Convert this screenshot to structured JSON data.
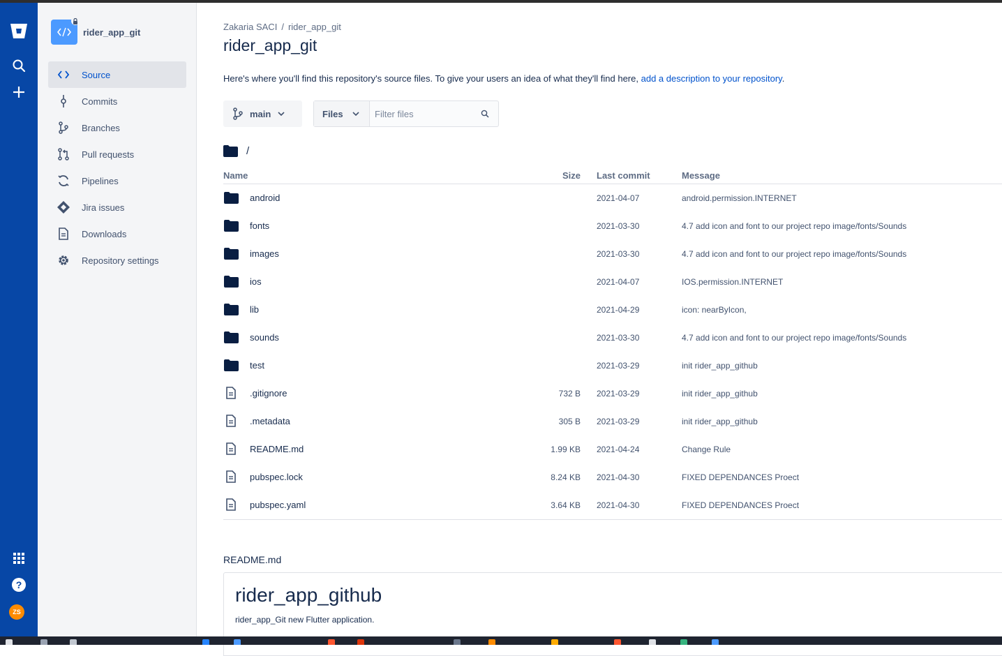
{
  "global_nav": {
    "items": [
      {
        "name": "bitbucket-logo",
        "icon": "bitbucket-logo-icon"
      },
      {
        "name": "search",
        "icon": "search-icon"
      },
      {
        "name": "create",
        "icon": "plus-icon"
      }
    ],
    "bottom": [
      {
        "name": "apps",
        "icon": "grid-icon"
      },
      {
        "name": "help",
        "icon": "help-icon"
      }
    ],
    "avatar_initials": "ZS",
    "colors": {
      "background": "#0747a6",
      "avatar": "#ff8b00"
    }
  },
  "sidebar": {
    "repo_name": "rider_app_git",
    "items": [
      {
        "label": "Source",
        "icon": "code-icon",
        "active": true
      },
      {
        "label": "Commits",
        "icon": "commit-icon"
      },
      {
        "label": "Branches",
        "icon": "branch-icon"
      },
      {
        "label": "Pull requests",
        "icon": "pull-request-icon"
      },
      {
        "label": "Pipelines",
        "icon": "pipelines-icon"
      },
      {
        "label": "Jira issues",
        "icon": "jira-icon"
      },
      {
        "label": "Downloads",
        "icon": "document-icon"
      },
      {
        "label": "Repository settings",
        "icon": "gear-icon"
      }
    ]
  },
  "main": {
    "breadcrumb": [
      "Zakaria SACI",
      "rider_app_git"
    ],
    "title": "rider_app_git",
    "intro_text": "Here's where you'll find this repository's source files. To give your users an idea of what they'll find here,",
    "intro_link": "add a description to your repository",
    "intro_end": ".",
    "branch": "main",
    "files_select": "Files",
    "filter_placeholder": "Filter files",
    "path": "/",
    "columns": {
      "name": "Name",
      "size": "Size",
      "last_commit": "Last commit",
      "message": "Message"
    },
    "rows": [
      {
        "type": "folder",
        "name": "android",
        "size": "",
        "date": "2021-04-07",
        "message": "android.permission.INTERNET"
      },
      {
        "type": "folder",
        "name": "fonts",
        "size": "",
        "date": "2021-03-30",
        "message": "4.7 add icon and font to our project repo image/fonts/Sounds"
      },
      {
        "type": "folder",
        "name": "images",
        "size": "",
        "date": "2021-03-30",
        "message": "4.7 add icon and font to our project repo image/fonts/Sounds"
      },
      {
        "type": "folder",
        "name": "ios",
        "size": "",
        "date": "2021-04-07",
        "message": "IOS.permission.INTERNET"
      },
      {
        "type": "folder",
        "name": "lib",
        "size": "",
        "date": "2021-04-29",
        "message": "icon: nearByIcon,"
      },
      {
        "type": "folder",
        "name": "sounds",
        "size": "",
        "date": "2021-03-30",
        "message": "4.7 add icon and font to our project repo image/fonts/Sounds"
      },
      {
        "type": "folder",
        "name": "test",
        "size": "",
        "date": "2021-03-29",
        "message": "init rider_app_github"
      },
      {
        "type": "file",
        "name": ".gitignore",
        "size": "732 B",
        "date": "2021-03-29",
        "message": "init rider_app_github"
      },
      {
        "type": "file",
        "name": ".metadata",
        "size": "305 B",
        "date": "2021-03-29",
        "message": "init rider_app_github"
      },
      {
        "type": "file",
        "name": "README.md",
        "size": "1.99 KB",
        "date": "2021-04-24",
        "message": "Change Rule"
      },
      {
        "type": "file",
        "name": "pubspec.lock",
        "size": "8.24 KB",
        "date": "2021-04-30",
        "message": "FIXED DEPENDANCES Proect"
      },
      {
        "type": "file",
        "name": "pubspec.yaml",
        "size": "3.64 KB",
        "date": "2021-04-30",
        "message": "FIXED DEPENDANCES Proect"
      }
    ],
    "readme": {
      "label": "README.md",
      "heading": "rider_app_github",
      "text": "rider_app_Git new Flutter application."
    }
  },
  "colors": {
    "link": "#0052cc",
    "text": "#172b4d",
    "active_nav": "#0052cc"
  }
}
